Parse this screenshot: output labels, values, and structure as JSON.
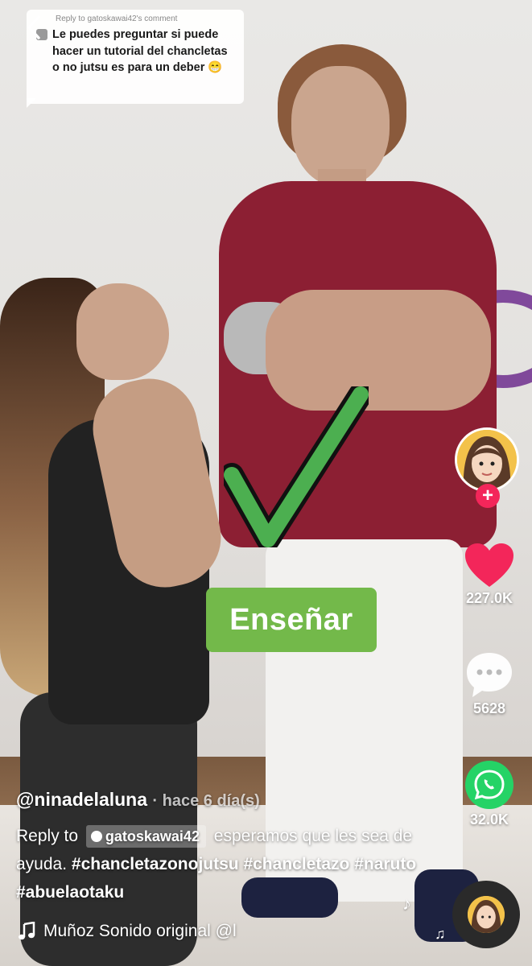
{
  "comment_sticker": {
    "reply_label": "Reply to gatoskawai42's comment",
    "text": "Le puedes preguntar si puede hacer un tutorial del chancletas o no jutsu es para un deber 😁"
  },
  "overlay": {
    "sticker_text": "Enseñar",
    "check_color": "#4caf50",
    "sticker_color": "#73b94a"
  },
  "rail": {
    "likes": "227.0K",
    "comments": "5628",
    "shares": "32.0K",
    "like_color": "#f3265a",
    "whatsapp_color": "#25d366"
  },
  "caption": {
    "author": "@ninadelaluna",
    "time": "· hace 6 día(s)",
    "reply_prefix": "Reply to",
    "reply_user": "gatoskawai42",
    "text_after": "esperamos que les sea de ayuda.",
    "hashtags": [
      "#chancletazonojutsu",
      "#chancletazo",
      "#naruto",
      "#abuelaotaku"
    ]
  },
  "sound": {
    "text": "Muñoz Sonido original    @l"
  }
}
